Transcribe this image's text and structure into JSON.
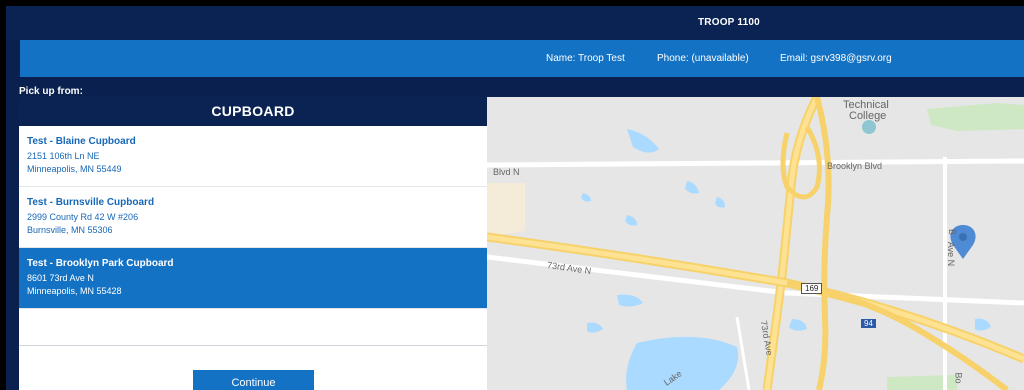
{
  "header": {
    "troop": "TROOP 1100"
  },
  "info": {
    "name": "Name: Troop Test",
    "phone": "Phone: (unavailable)",
    "email": "Email: gsrv398@gsrv.org"
  },
  "pickup_label": "Pick up from:",
  "cupboard_title": "CUPBOARD",
  "locations": [
    {
      "name": "Test - Blaine Cupboard",
      "address": "2151 106th Ln NE",
      "city": "Minneapolis, MN 55449"
    },
    {
      "name": "Test - Burnsville Cupboard",
      "address": "2999 County Rd 42 W #206",
      "city": "Burnsville, MN 55306"
    },
    {
      "name": "Test - Brooklyn Park Cupboard",
      "address": "8601 73rd Ave N",
      "city": "Minneapolis, MN 55428"
    }
  ],
  "selected_index": 2,
  "continue_label": "Continue",
  "map": {
    "labels": {
      "technical": "Technical",
      "college": "College",
      "blvd_n": "Blvd N",
      "brooklyn_blvd": "Brooklyn Blvd",
      "ave_73rd": "73rd Ave N",
      "ave_73rd_vertical": "73rd Ave",
      "lake": "Lake",
      "hwy_169": "169",
      "hwy_94": "94",
      "street_b": "B",
      "ave_n": "Ave N",
      "street_bo": "Bo"
    }
  }
}
